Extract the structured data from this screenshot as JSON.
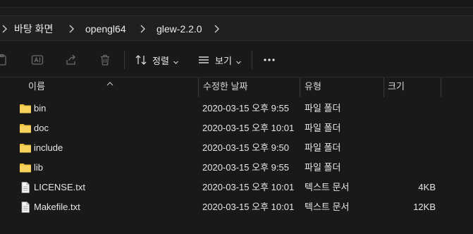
{
  "breadcrumb": {
    "items": [
      "바탕 화면",
      "opengl64",
      "glew-2.2.0"
    ]
  },
  "toolbar": {
    "sort_label": "정렬",
    "view_label": "보기"
  },
  "columns": {
    "name": "이름",
    "date": "수정한 날짜",
    "type": "유형",
    "size": "크기"
  },
  "files": [
    {
      "name": "bin",
      "date": "2020-03-15 오후 9:55",
      "type": "파일 폴더",
      "size": "",
      "icon": "folder-icon"
    },
    {
      "name": "doc",
      "date": "2020-03-15 오후 10:01",
      "type": "파일 폴더",
      "size": "",
      "icon": "folder-icon"
    },
    {
      "name": "include",
      "date": "2020-03-15 오후 9:50",
      "type": "파일 폴더",
      "size": "",
      "icon": "folder-icon"
    },
    {
      "name": "lib",
      "date": "2020-03-15 오후 9:55",
      "type": "파일 폴더",
      "size": "",
      "icon": "folder-icon"
    },
    {
      "name": "LICENSE.txt",
      "date": "2020-03-15 오후 10:01",
      "type": "텍스트 문서",
      "size": "4KB",
      "icon": "text-file-icon"
    },
    {
      "name": "Makefile.txt",
      "date": "2020-03-15 오후 10:01",
      "type": "텍스트 문서",
      "size": "12KB",
      "icon": "text-file-icon"
    }
  ],
  "colors": {
    "background": "#191919",
    "folder": "#f0c341",
    "text": "#e6e6e6"
  }
}
